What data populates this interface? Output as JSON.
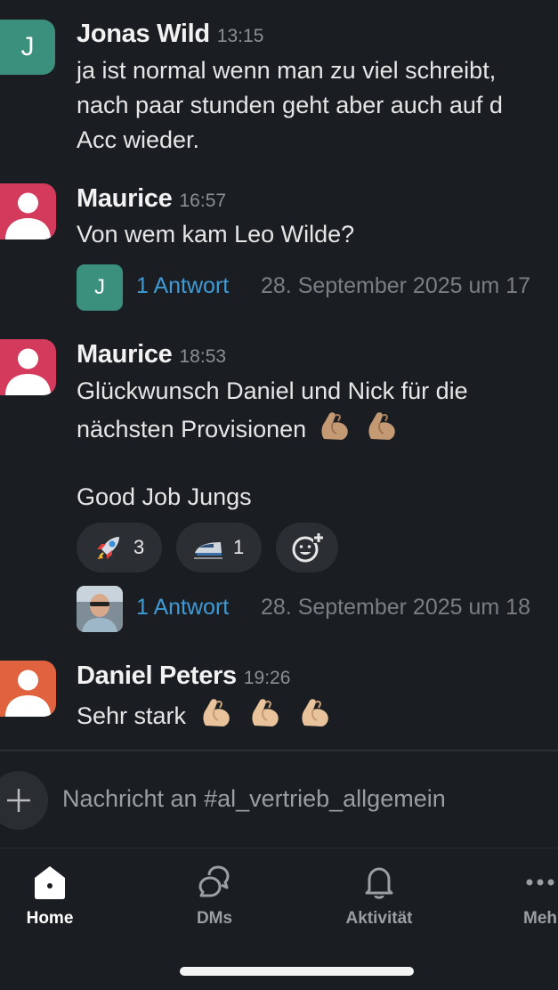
{
  "messages": [
    {
      "author": "Jonas Wild",
      "time": "13:15",
      "avatar_letter": "J",
      "lines": [
        "ja ist normal wenn man zu viel schreibt,",
        "nach paar stunden geht aber auch auf d",
        "Acc wieder."
      ]
    },
    {
      "author": "Maurice",
      "time": "16:57",
      "lines": [
        "Von wem kam Leo Wilde?"
      ],
      "thread": {
        "avatar_letter": "J",
        "replies": "1 Antwort",
        "date": "28. September 2025 um 17"
      }
    },
    {
      "author": "Maurice",
      "time": "18:53",
      "lines": [
        "Glückwunsch Daniel und Nick für die",
        "nächsten Provisionen",
        "Good Job Jungs"
      ],
      "reactions": [
        {
          "emoji": "rocket-emoji",
          "count": "3"
        },
        {
          "emoji": "high-speed-train-emoji",
          "count": "1"
        }
      ],
      "thread": {
        "replies": "1 Antwort",
        "date": "28. September 2025 um 18"
      }
    },
    {
      "author": "Daniel Peters",
      "time": "19:26",
      "lines": [
        "Sehr stark"
      ]
    }
  ],
  "composer": {
    "placeholder": "Nachricht an #al_vertrieb_allgemein"
  },
  "tabs": [
    {
      "label": "Home",
      "icon": "home-icon",
      "active": true
    },
    {
      "label": "DMs",
      "icon": "dms-icon"
    },
    {
      "label": "Aktivität",
      "icon": "bell-icon"
    },
    {
      "label": "Meh",
      "icon": "more-icon"
    }
  ],
  "colors": {
    "background": "#1a1d21",
    "link": "#3f9bd6",
    "avatar_green": "#3b8f7d",
    "avatar_red": "#d33a5b",
    "avatar_orange": "#e0623f"
  }
}
